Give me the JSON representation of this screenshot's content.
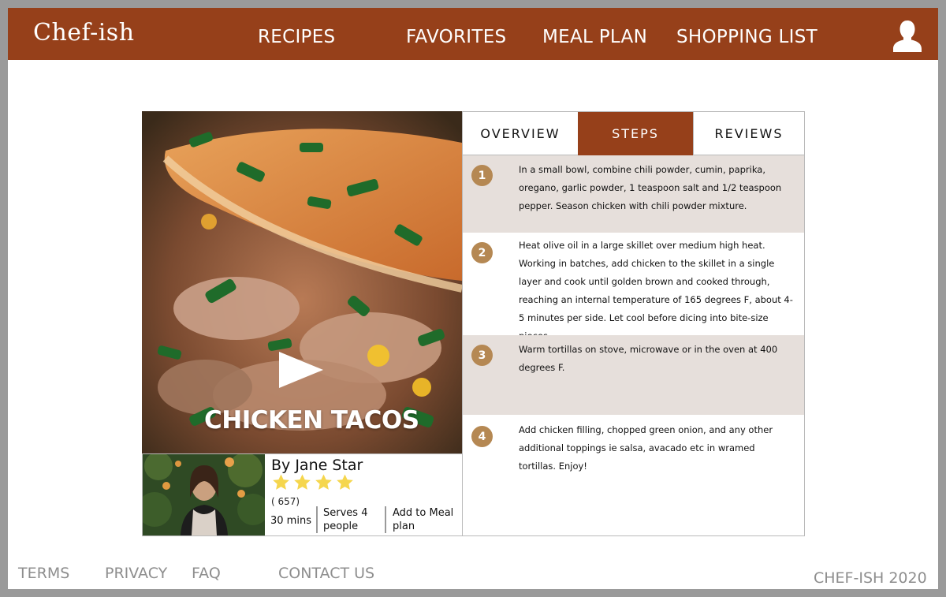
{
  "header": {
    "logo": "Chef-ish",
    "nav": [
      "RECIPES",
      "FAVORITES",
      "MEAL PLAN",
      "SHOPPING LIST"
    ],
    "user_icon": "user-icon"
  },
  "recipe": {
    "title": "CHICKEN TACOS",
    "play_icon": "play-icon",
    "author": "By Jane Star",
    "rating_stars": 4,
    "rating_count": "( 657)",
    "time": "30 mins",
    "serves": "Serves 4 people",
    "add_to_plan": "Add to Meal plan"
  },
  "tabs": [
    {
      "label": "OVERVIEW",
      "active": false
    },
    {
      "label": "STEPS",
      "active": true
    },
    {
      "label": "REVIEWS",
      "active": false
    }
  ],
  "steps": [
    {
      "num": "1",
      "text": "In a small bowl, combine chili powder, cumin, paprika, oregano, garlic powder, 1 teaspoon salt and 1/2 teaspoon pepper. Season chicken with chili powder mixture."
    },
    {
      "num": "2",
      "text": "Heat olive oil  in a large skillet over medium high heat. Working in batches, add chicken to the skillet in a single layer and cook until golden brown and cooked through, reaching an internal temperature of 165 degrees F, about 4-5 minutes per side. Let cool before dicing into bite-size pieces."
    },
    {
      "num": "3",
      "text": "Warm tortillas on stove, microwave or in the oven at 400 degrees F."
    },
    {
      "num": "4",
      "text": "Add chicken filling, chopped green onion, and any other additional toppings ie salsa, avacado etc in wramed tortillas. Enjoy!"
    }
  ],
  "footer": {
    "links": [
      "TERMS",
      "PRIVACY",
      "FAQ",
      "CONTACT US"
    ],
    "copyright": "CHEF-ISH 2020"
  },
  "colors": {
    "brand": "#96401a",
    "step_badge": "#b58853",
    "shaded_row": "#e6dfdb",
    "star": "#f5d64d"
  }
}
